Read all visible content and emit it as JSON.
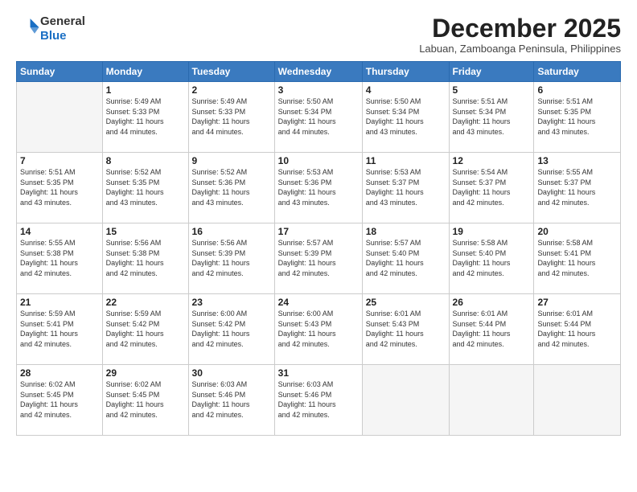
{
  "header": {
    "logo_line1": "General",
    "logo_line2": "Blue",
    "month": "December 2025",
    "location": "Labuan, Zamboanga Peninsula, Philippines"
  },
  "weekdays": [
    "Sunday",
    "Monday",
    "Tuesday",
    "Wednesday",
    "Thursday",
    "Friday",
    "Saturday"
  ],
  "weeks": [
    [
      {
        "day": "",
        "info": ""
      },
      {
        "day": "1",
        "info": "Sunrise: 5:49 AM\nSunset: 5:33 PM\nDaylight: 11 hours\nand 44 minutes."
      },
      {
        "day": "2",
        "info": "Sunrise: 5:49 AM\nSunset: 5:33 PM\nDaylight: 11 hours\nand 44 minutes."
      },
      {
        "day": "3",
        "info": "Sunrise: 5:50 AM\nSunset: 5:34 PM\nDaylight: 11 hours\nand 44 minutes."
      },
      {
        "day": "4",
        "info": "Sunrise: 5:50 AM\nSunset: 5:34 PM\nDaylight: 11 hours\nand 43 minutes."
      },
      {
        "day": "5",
        "info": "Sunrise: 5:51 AM\nSunset: 5:34 PM\nDaylight: 11 hours\nand 43 minutes."
      },
      {
        "day": "6",
        "info": "Sunrise: 5:51 AM\nSunset: 5:35 PM\nDaylight: 11 hours\nand 43 minutes."
      }
    ],
    [
      {
        "day": "7",
        "info": "Sunrise: 5:51 AM\nSunset: 5:35 PM\nDaylight: 11 hours\nand 43 minutes."
      },
      {
        "day": "8",
        "info": "Sunrise: 5:52 AM\nSunset: 5:35 PM\nDaylight: 11 hours\nand 43 minutes."
      },
      {
        "day": "9",
        "info": "Sunrise: 5:52 AM\nSunset: 5:36 PM\nDaylight: 11 hours\nand 43 minutes."
      },
      {
        "day": "10",
        "info": "Sunrise: 5:53 AM\nSunset: 5:36 PM\nDaylight: 11 hours\nand 43 minutes."
      },
      {
        "day": "11",
        "info": "Sunrise: 5:53 AM\nSunset: 5:37 PM\nDaylight: 11 hours\nand 43 minutes."
      },
      {
        "day": "12",
        "info": "Sunrise: 5:54 AM\nSunset: 5:37 PM\nDaylight: 11 hours\nand 42 minutes."
      },
      {
        "day": "13",
        "info": "Sunrise: 5:55 AM\nSunset: 5:37 PM\nDaylight: 11 hours\nand 42 minutes."
      }
    ],
    [
      {
        "day": "14",
        "info": "Sunrise: 5:55 AM\nSunset: 5:38 PM\nDaylight: 11 hours\nand 42 minutes."
      },
      {
        "day": "15",
        "info": "Sunrise: 5:56 AM\nSunset: 5:38 PM\nDaylight: 11 hours\nand 42 minutes."
      },
      {
        "day": "16",
        "info": "Sunrise: 5:56 AM\nSunset: 5:39 PM\nDaylight: 11 hours\nand 42 minutes."
      },
      {
        "day": "17",
        "info": "Sunrise: 5:57 AM\nSunset: 5:39 PM\nDaylight: 11 hours\nand 42 minutes."
      },
      {
        "day": "18",
        "info": "Sunrise: 5:57 AM\nSunset: 5:40 PM\nDaylight: 11 hours\nand 42 minutes."
      },
      {
        "day": "19",
        "info": "Sunrise: 5:58 AM\nSunset: 5:40 PM\nDaylight: 11 hours\nand 42 minutes."
      },
      {
        "day": "20",
        "info": "Sunrise: 5:58 AM\nSunset: 5:41 PM\nDaylight: 11 hours\nand 42 minutes."
      }
    ],
    [
      {
        "day": "21",
        "info": "Sunrise: 5:59 AM\nSunset: 5:41 PM\nDaylight: 11 hours\nand 42 minutes."
      },
      {
        "day": "22",
        "info": "Sunrise: 5:59 AM\nSunset: 5:42 PM\nDaylight: 11 hours\nand 42 minutes."
      },
      {
        "day": "23",
        "info": "Sunrise: 6:00 AM\nSunset: 5:42 PM\nDaylight: 11 hours\nand 42 minutes."
      },
      {
        "day": "24",
        "info": "Sunrise: 6:00 AM\nSunset: 5:43 PM\nDaylight: 11 hours\nand 42 minutes."
      },
      {
        "day": "25",
        "info": "Sunrise: 6:01 AM\nSunset: 5:43 PM\nDaylight: 11 hours\nand 42 minutes."
      },
      {
        "day": "26",
        "info": "Sunrise: 6:01 AM\nSunset: 5:44 PM\nDaylight: 11 hours\nand 42 minutes."
      },
      {
        "day": "27",
        "info": "Sunrise: 6:01 AM\nSunset: 5:44 PM\nDaylight: 11 hours\nand 42 minutes."
      }
    ],
    [
      {
        "day": "28",
        "info": "Sunrise: 6:02 AM\nSunset: 5:45 PM\nDaylight: 11 hours\nand 42 minutes."
      },
      {
        "day": "29",
        "info": "Sunrise: 6:02 AM\nSunset: 5:45 PM\nDaylight: 11 hours\nand 42 minutes."
      },
      {
        "day": "30",
        "info": "Sunrise: 6:03 AM\nSunset: 5:46 PM\nDaylight: 11 hours\nand 42 minutes."
      },
      {
        "day": "31",
        "info": "Sunrise: 6:03 AM\nSunset: 5:46 PM\nDaylight: 11 hours\nand 42 minutes."
      },
      {
        "day": "",
        "info": ""
      },
      {
        "day": "",
        "info": ""
      },
      {
        "day": "",
        "info": ""
      }
    ]
  ]
}
